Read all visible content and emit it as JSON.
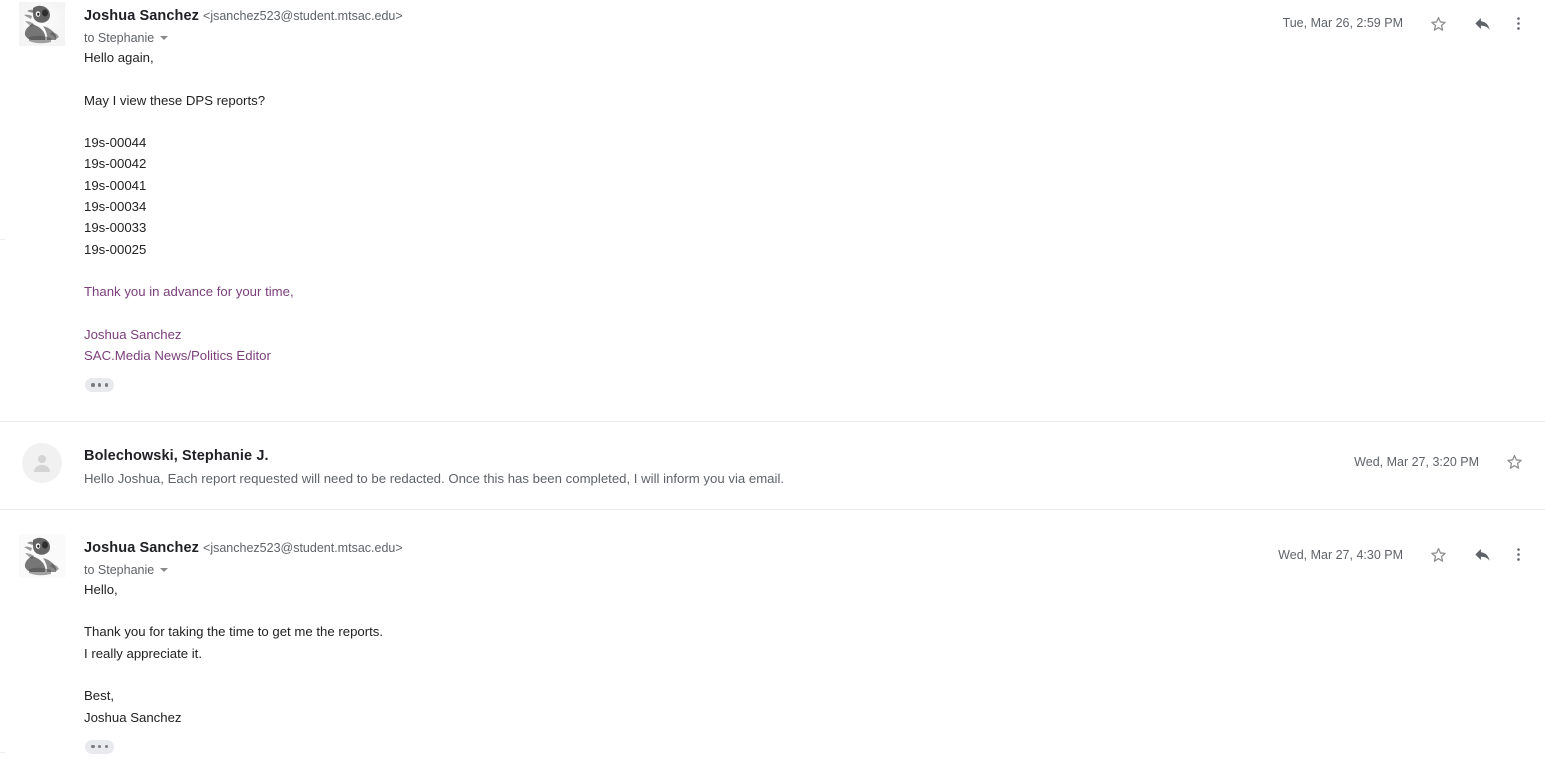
{
  "thread": {
    "messages": [
      {
        "type": "expanded",
        "avatar": "photo-avatar",
        "sender_name": "Joshua Sanchez",
        "sender_email": "<jsanchez523@student.mtsac.edu>",
        "recipient": "to Stephanie",
        "timestamp": "Tue, Mar 26, 2:59 PM",
        "body": [
          {
            "text": "Hello again,",
            "style": "normal"
          },
          {
            "text": "",
            "style": "blank"
          },
          {
            "text": "May I view these DPS reports?",
            "style": "normal"
          },
          {
            "text": "",
            "style": "blank"
          },
          {
            "text": "19s-00044",
            "style": "normal"
          },
          {
            "text": "19s-00042",
            "style": "normal"
          },
          {
            "text": "19s-00041",
            "style": "normal"
          },
          {
            "text": "19s-00034",
            "style": "normal"
          },
          {
            "text": "19s-00033",
            "style": "normal"
          },
          {
            "text": "19s-00025",
            "style": "normal"
          },
          {
            "text": "",
            "style": "blank"
          },
          {
            "text": "Thank you in advance for your time,",
            "style": "signature"
          },
          {
            "text": "",
            "style": "blank"
          },
          {
            "text": "Joshua Sanchez",
            "style": "signature"
          },
          {
            "text": "SAC.Media News/Politics Editor",
            "style": "signature"
          }
        ],
        "expand_button": "show-trimmed-content"
      },
      {
        "type": "collapsed",
        "avatar": "generic-avatar",
        "sender_name": "Bolechowski, Stephanie J.",
        "snippet": "Hello Joshua, Each report requested will need to be redacted. Once this has been completed, I will inform you via email.",
        "timestamp": "Wed, Mar 27, 3:20 PM"
      },
      {
        "type": "expanded",
        "avatar": "photo-avatar",
        "sender_name": "Joshua Sanchez",
        "sender_email": "<jsanchez523@student.mtsac.edu>",
        "recipient": "to Stephanie",
        "timestamp": "Wed, Mar 27, 4:30 PM",
        "body": [
          {
            "text": "Hello,",
            "style": "normal"
          },
          {
            "text": "",
            "style": "blank"
          },
          {
            "text": "Thank you for taking the time to get me the reports.",
            "style": "normal"
          },
          {
            "text": "I really appreciate it.",
            "style": "normal"
          },
          {
            "text": "",
            "style": "blank"
          },
          {
            "text": "Best,",
            "style": "normal"
          },
          {
            "text": "Joshua Sanchez",
            "style": "normal"
          }
        ],
        "expand_button": "show-trimmed-content"
      }
    ]
  },
  "icons": {
    "star": "star-icon",
    "reply": "reply-icon",
    "more": "more-options-icon",
    "recipient_caret": "chevron-down-icon"
  },
  "colors": {
    "signature_text": "#7b3f7b",
    "secondary_text": "#5f6368",
    "primary_text": "#222222",
    "divider": "#e8eaed",
    "dots_button_bg": "#e8eaed"
  }
}
